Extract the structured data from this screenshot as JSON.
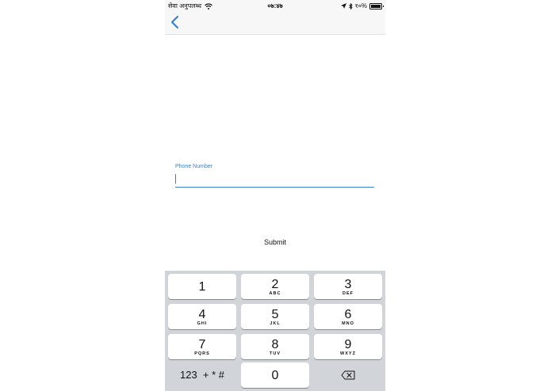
{
  "status_bar": {
    "carrier": "सेवा अनुपलब्ध",
    "time": "०७:४७",
    "battery_percent": "१०%",
    "icons": [
      "wifi-icon",
      "location-arrow-icon",
      "bluetooth-icon",
      "battery-icon"
    ]
  },
  "nav": {
    "back_icon": "chevron-left-icon"
  },
  "form": {
    "phone_label": "Phone Number",
    "phone_value": "",
    "submit_label": "Submit"
  },
  "keypad": {
    "keys": [
      {
        "digit": "1",
        "letters": ""
      },
      {
        "digit": "2",
        "letters": "ABC"
      },
      {
        "digit": "3",
        "letters": "DEF"
      },
      {
        "digit": "4",
        "letters": "GHI"
      },
      {
        "digit": "5",
        "letters": "JKL"
      },
      {
        "digit": "6",
        "letters": "MNO"
      },
      {
        "digit": "7",
        "letters": "PQRS"
      },
      {
        "digit": "8",
        "letters": "TUV"
      },
      {
        "digit": "9",
        "letters": "WXYZ"
      },
      {
        "digit": "0",
        "letters": ""
      }
    ],
    "symbols_label": "123  + * #",
    "delete_icon": "backspace-icon"
  },
  "colors": {
    "accent": "#3b82c4",
    "keyboard_bg": "#d1d4d9",
    "key_bg": "#ffffff"
  }
}
